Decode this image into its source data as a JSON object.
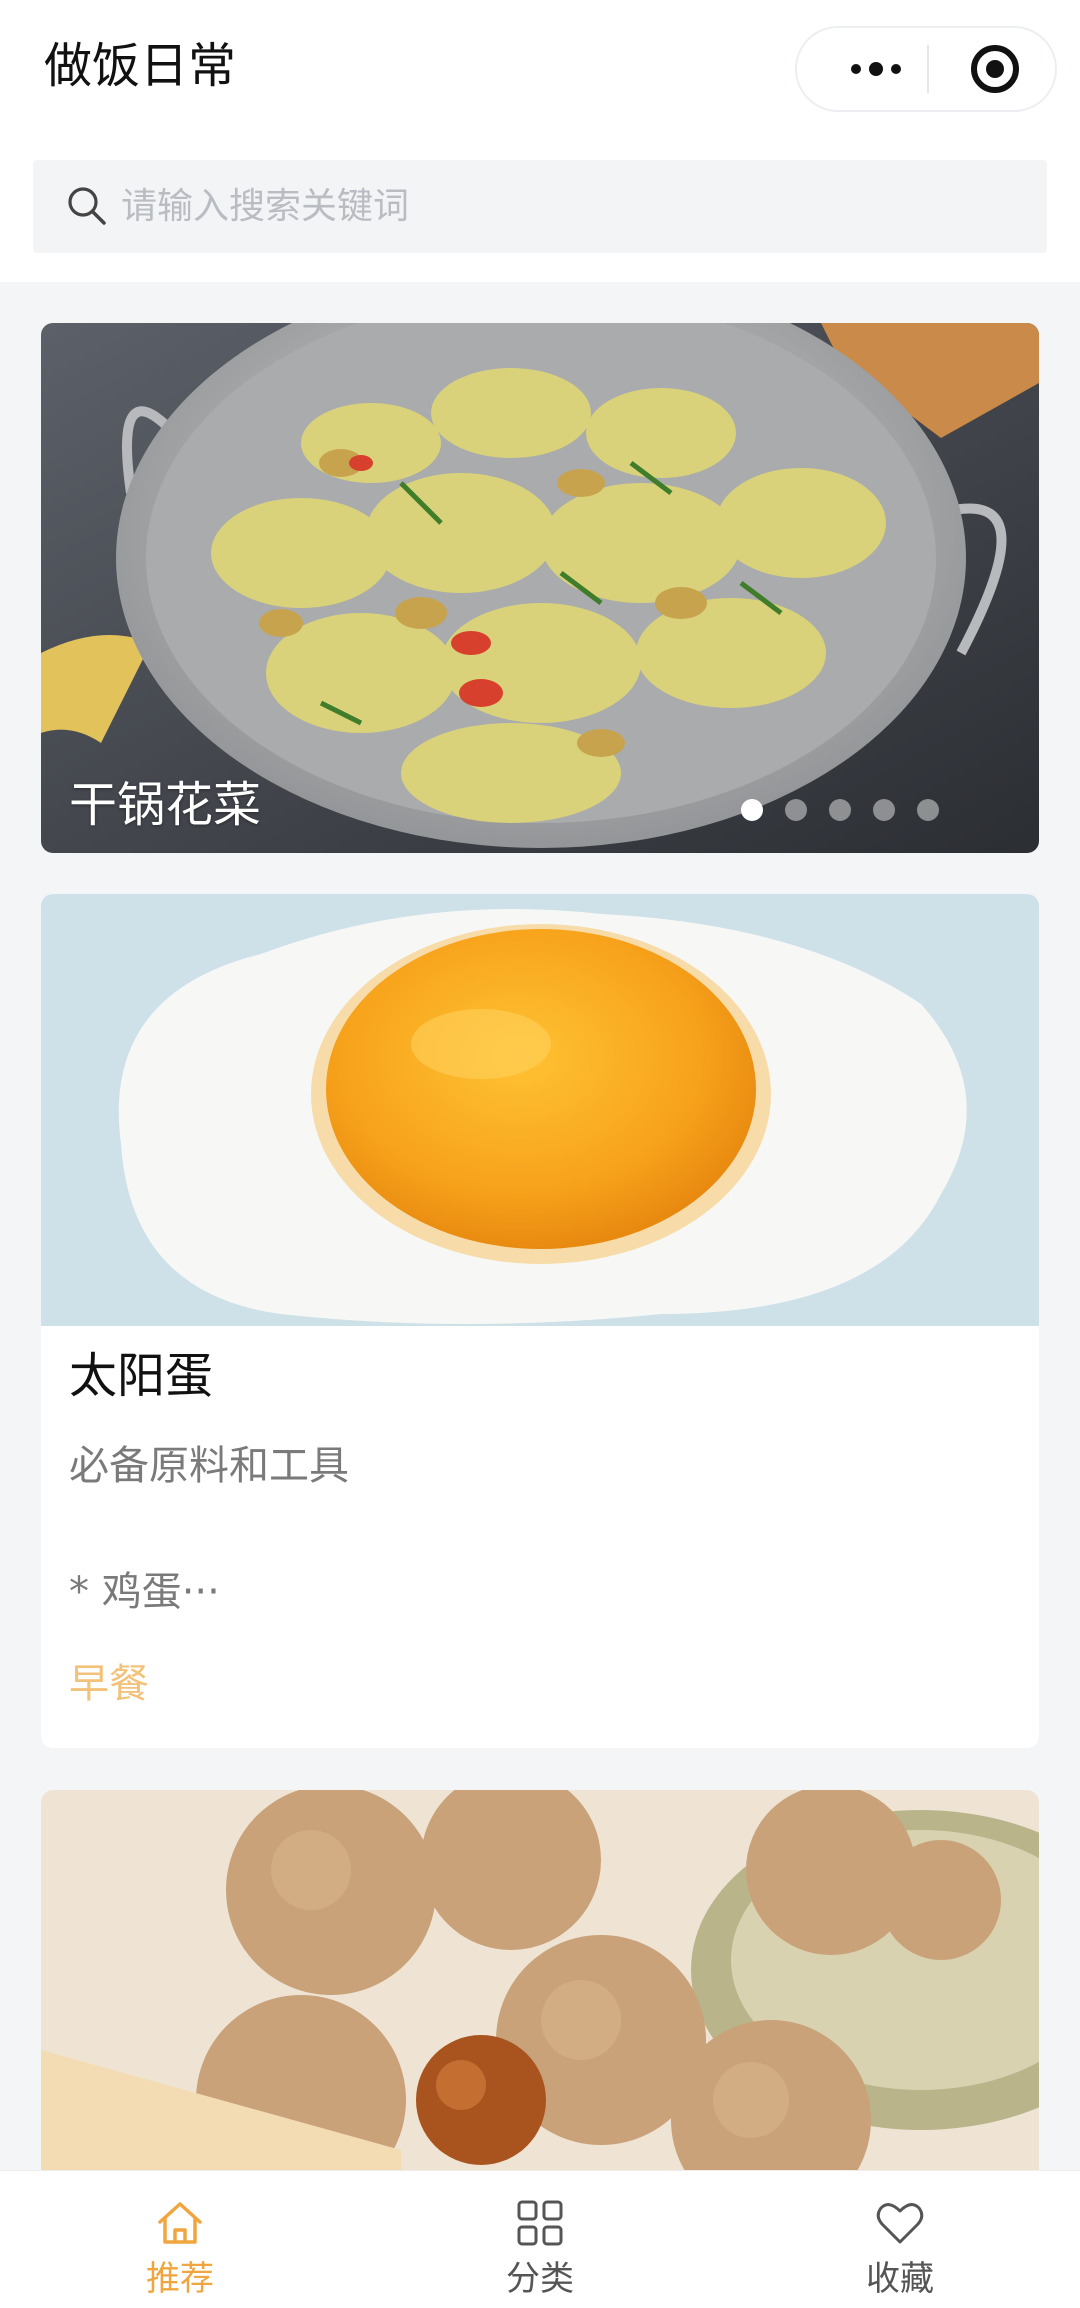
{
  "app": {
    "title": "做饭日常"
  },
  "search": {
    "placeholder": "请输入搜索关键词",
    "value": ""
  },
  "banner": {
    "caption": "干锅花菜",
    "slide_count": 5,
    "active_slide": 1
  },
  "recipe_card": {
    "title": "太阳蛋",
    "subtitle": "必备原料和工具",
    "ingredients": "* 鸡蛋···",
    "tag": "早餐"
  },
  "tabbar": {
    "items": [
      {
        "label": "推荐",
        "icon": "home-icon",
        "active": true
      },
      {
        "label": "分类",
        "icon": "grid-icon",
        "active": false
      },
      {
        "label": "收藏",
        "icon": "heart-icon",
        "active": false
      }
    ]
  },
  "colors": {
    "accent": "#f0a640",
    "tag": "#f3c27a",
    "background": "#f4f5f7"
  }
}
